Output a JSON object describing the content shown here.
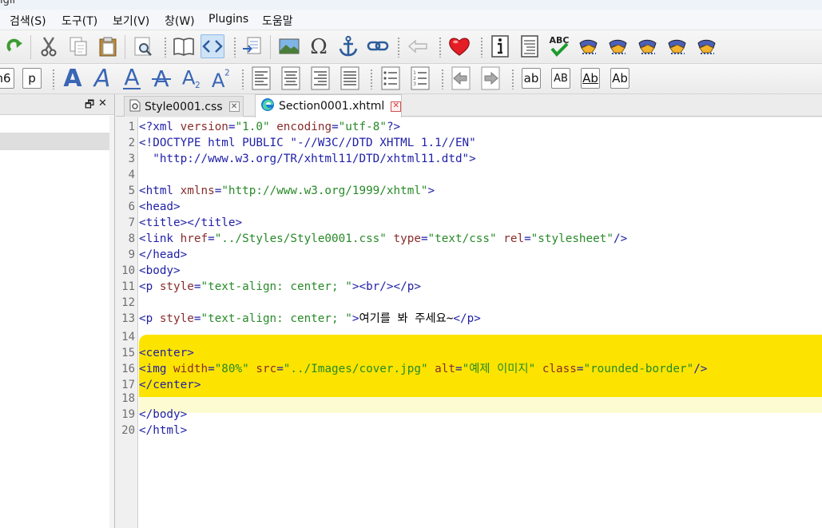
{
  "window": {
    "title_fragment": "igil"
  },
  "menu": [
    "검색(S)",
    "도구(T)",
    "보기(V)",
    "창(W)",
    "Plugins",
    "도움말"
  ],
  "toolbar1": {
    "icons": [
      "redo-icon",
      "cut-icon",
      "copy-icon",
      "paste-icon",
      "find-icon",
      "book-view-icon",
      "code-view-icon",
      "insert-file-icon",
      "insert-image-icon",
      "omega-symbol-icon",
      "anchor-icon",
      "link-icon",
      "back-arrow-icon",
      "favorite-heart-icon",
      "metadata-info-icon",
      "toc-icon",
      "spellcheck-icon",
      "plugin-icon-1",
      "plugin-icon-2",
      "plugin-icon-3",
      "plugin-icon-4",
      "plugin-icon-5"
    ],
    "spellcheck_text": "ABC"
  },
  "toolbar2": {
    "heading_partial": "h6",
    "paragraph_label": "p",
    "case_buttons": [
      "ab",
      "AB",
      "Ab",
      "Ab"
    ]
  },
  "left_panel": {
    "float_symbol": "🗗",
    "close_symbol": "✕"
  },
  "tabs": [
    {
      "label": "Style0001.css",
      "icon": "css-file-icon",
      "active": false
    },
    {
      "label": "Section0001.xhtml",
      "icon": "edge-browser-icon",
      "active": true
    }
  ],
  "editor": {
    "line_numbers": [
      "1",
      "2",
      "3",
      "4",
      "5",
      "6",
      "7",
      "8",
      "9",
      "10",
      "11",
      "12",
      "13",
      "14",
      "15",
      "16",
      "17",
      "18",
      "19",
      "20"
    ],
    "lines": [
      [
        [
          "tag",
          "<?xml "
        ],
        [
          "attr",
          "version"
        ],
        [
          "tag",
          "="
        ],
        [
          "str",
          "\"1.0\""
        ],
        [
          "tag",
          " "
        ],
        [
          "attr",
          "encoding"
        ],
        [
          "tag",
          "="
        ],
        [
          "str",
          "\"utf-8\""
        ],
        [
          "tag",
          "?>"
        ]
      ],
      [
        [
          "tag",
          "<!DOCTYPE html PUBLIC \"-//W3C//DTD XHTML 1.1//EN\""
        ]
      ],
      [
        [
          "tag",
          "  \"http://www.w3.org/TR/xhtml11/DTD/xhtml11.dtd\">"
        ]
      ],
      [],
      [
        [
          "tag",
          "<html "
        ],
        [
          "attr",
          "xmlns"
        ],
        [
          "tag",
          "="
        ],
        [
          "str",
          "\"http://www.w3.org/1999/xhtml\""
        ],
        [
          "tag",
          ">"
        ]
      ],
      [
        [
          "tag",
          "<head>"
        ]
      ],
      [
        [
          "tag",
          "<title></title>"
        ]
      ],
      [
        [
          "tag",
          "<link "
        ],
        [
          "attr",
          "href"
        ],
        [
          "tag",
          "="
        ],
        [
          "str",
          "\"../Styles/Style0001.css\""
        ],
        [
          "tag",
          " "
        ],
        [
          "attr",
          "type"
        ],
        [
          "tag",
          "="
        ],
        [
          "str",
          "\"text/css\""
        ],
        [
          "tag",
          " "
        ],
        [
          "attr",
          "rel"
        ],
        [
          "tag",
          "="
        ],
        [
          "str",
          "\"stylesheet\""
        ],
        [
          "tag",
          "/>"
        ]
      ],
      [
        [
          "tag",
          "</head>"
        ]
      ],
      [
        [
          "tag",
          "<body>"
        ]
      ],
      [
        [
          "tag",
          "<p "
        ],
        [
          "attr",
          "style"
        ],
        [
          "tag",
          "="
        ],
        [
          "str",
          "\"text-align: center; \""
        ],
        [
          "tag",
          "><br/></p>"
        ]
      ],
      [],
      [
        [
          "tag",
          "<p "
        ],
        [
          "attr",
          "style"
        ],
        [
          "tag",
          "="
        ],
        [
          "str",
          "\"text-align: center; \""
        ],
        [
          "tag",
          ">"
        ],
        [
          "text",
          "여기를 봐 주세요~"
        ],
        [
          "tag",
          "</p>"
        ]
      ],
      [],
      [
        [
          "tag",
          "<center>"
        ]
      ],
      [
        [
          "tag",
          "<img "
        ],
        [
          "attr",
          "width"
        ],
        [
          "tag",
          "="
        ],
        [
          "str",
          "\"80%\""
        ],
        [
          "tag",
          " "
        ],
        [
          "attr",
          "src"
        ],
        [
          "tag",
          "="
        ],
        [
          "str",
          "\"../Images/cover.jpg\""
        ],
        [
          "tag",
          " "
        ],
        [
          "attr",
          "alt"
        ],
        [
          "tag",
          "="
        ],
        [
          "str",
          "\"예제 이미지\""
        ],
        [
          "tag",
          " "
        ],
        [
          "attr",
          "class"
        ],
        [
          "tag",
          "="
        ],
        [
          "str",
          "\"rounded-border\""
        ],
        [
          "tag",
          "/>"
        ]
      ],
      [
        [
          "tag",
          "</center>"
        ]
      ],
      [],
      [
        [
          "tag",
          "</body>"
        ]
      ],
      [
        [
          "tag",
          "</html>"
        ]
      ]
    ]
  },
  "colors": {
    "highlight": "#fce400",
    "current_line": "#fdfbd2",
    "tag": "#1f1fa8",
    "attribute": "#8a2c2c",
    "string": "#288a28"
  }
}
